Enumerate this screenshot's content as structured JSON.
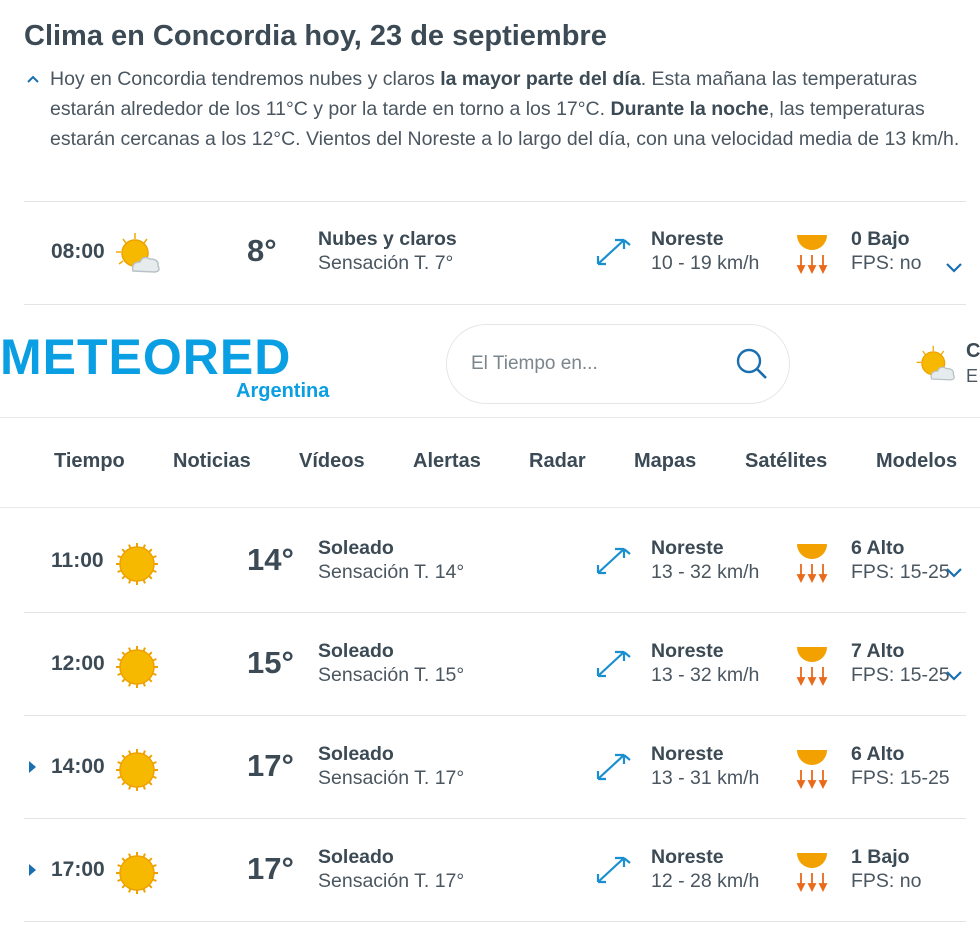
{
  "page": {
    "title": "Clima en Concordia hoy, 23 de septiembre",
    "summary": {
      "p1": "Hoy en Concordia tendremos nubes y claros ",
      "b1": "la mayor parte del día",
      "p2": ". Esta mañana las temperaturas estarán alrededor de los 11°C y por la tarde en torno a los 17°C. ",
      "b2": "Durante la noche",
      "p3": ", las temperaturas estarán cercanas a los 12°C. Vientos del Noreste a lo largo del día, con una velocidad media de 13 km/h."
    }
  },
  "header": {
    "logo_text": "METEORED",
    "logo_sub": "Argentina",
    "search_placeholder": "El Tiempo en...",
    "right_partial_1": "C",
    "right_partial_2": "E"
  },
  "nav": [
    "Tiempo",
    "Noticias",
    "Vídeos",
    "Alertas",
    "Radar",
    "Mapas",
    "Satélites",
    "Modelos"
  ],
  "rows": [
    {
      "time": "08:00",
      "icon": "partly-cloudy-icon",
      "temp": "8°",
      "desc": "Nubes y claros",
      "feel": "Sensación T. 7°",
      "wind_dir": "Noreste",
      "wind_speed": "10 - 19 km/h",
      "uv": "0 Bajo",
      "fps": "FPS: no"
    },
    {
      "time": "11:00",
      "icon": "sun-icon",
      "temp": "14°",
      "desc": "Soleado",
      "feel": "Sensación T. 14°",
      "wind_dir": "Noreste",
      "wind_speed": "13 - 32 km/h",
      "uv": "6 Alto",
      "fps": "FPS: 15-25"
    },
    {
      "time": "12:00",
      "icon": "sun-icon",
      "temp": "15°",
      "desc": "Soleado",
      "feel": "Sensación T. 15°",
      "wind_dir": "Noreste",
      "wind_speed": "13 - 32 km/h",
      "uv": "7 Alto",
      "fps": "FPS: 15-25"
    },
    {
      "time": "14:00",
      "icon": "sun-icon",
      "temp": "17°",
      "desc": "Soleado",
      "feel": "Sensación T. 17°",
      "wind_dir": "Noreste",
      "wind_speed": "13 - 31 km/h",
      "uv": "6 Alto",
      "fps": "FPS: 15-25"
    },
    {
      "time": "17:00",
      "icon": "sun-icon",
      "temp": "17°",
      "desc": "Soleado",
      "feel": "Sensación T. 17°",
      "wind_dir": "Noreste",
      "wind_speed": "12 - 28 km/h",
      "uv": "1 Bajo",
      "fps": "FPS: no"
    }
  ],
  "colors": {
    "brand": "#0a9ee2",
    "text": "#3b4a54",
    "accent_icon": "#1a8fd0",
    "sun": "#f5b800"
  }
}
